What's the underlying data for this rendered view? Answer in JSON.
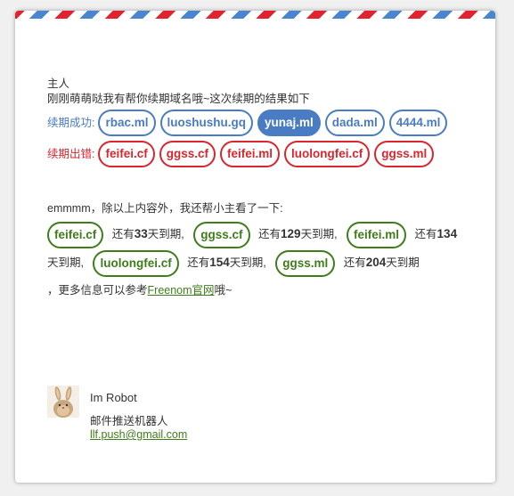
{
  "greeting": "主人",
  "intro": "刚刚萌萌哒我有帮你续期域名哦~这次续期的结果如下",
  "renew_success": {
    "label": "续期成功:",
    "domains": [
      "rbac.ml",
      "luoshushu.gq",
      "yunaj.ml",
      "dada.ml",
      "4444.ml"
    ]
  },
  "renew_error": {
    "label": "续期出错:",
    "domains": [
      "feifei.cf",
      "ggss.cf",
      "feifei.ml",
      "luolongfei.cf",
      "ggss.ml"
    ]
  },
  "expiry": {
    "intro": "emmmm，除以上内容外，我还帮小主看了一下:",
    "prefix": "还有",
    "suffix": "天到期,",
    "last_suffix": "天到期",
    "items": [
      {
        "domain": "feifei.cf",
        "days": "33"
      },
      {
        "domain": "ggss.cf",
        "days": "129"
      },
      {
        "domain": "feifei.ml",
        "days": "134"
      },
      {
        "domain": "luolongfei.cf",
        "days": "154"
      },
      {
        "domain": "ggss.ml",
        "days": "204"
      }
    ],
    "more_prefix": "，更多信息可以参考",
    "more_link": "Freenom官网",
    "more_suffix": "哦~"
  },
  "signature": {
    "name": "Im Robot",
    "role": "邮件推送机器人",
    "email": "llf.push@gmail.com"
  },
  "colors": {
    "success_blue": "#4a7cc4",
    "error_red": "#d9262e",
    "green": "#3f7d1b"
  },
  "icons": {
    "avatar": "rabbit-avatar-icon"
  }
}
